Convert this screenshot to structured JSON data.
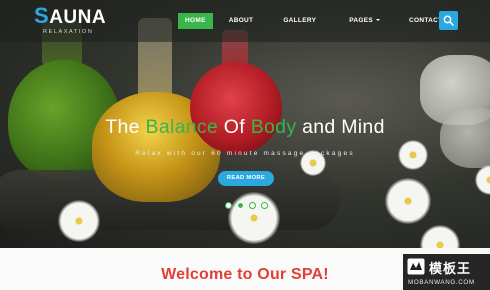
{
  "logo": {
    "first_letter": "S",
    "rest": "AUNA",
    "tagline": "RELAXATION"
  },
  "nav": {
    "items": [
      {
        "label": "HOME",
        "active": true
      },
      {
        "label": "ABOUT",
        "active": false
      },
      {
        "label": "GALLERY",
        "active": false
      },
      {
        "label": "PAGES",
        "active": false,
        "dropdown": true
      },
      {
        "label": "CONTACT",
        "active": false
      }
    ],
    "search_icon": "search-icon"
  },
  "hero": {
    "title_parts": [
      "The ",
      "Balance",
      " Of ",
      "Body",
      " and Mind"
    ],
    "subtitle": "Relax with our 60 minute massage packages",
    "button_label": "READ MORE",
    "slider_dots": 4,
    "active_dot": 1
  },
  "welcome": {
    "title": "Welcome to Our SPA!"
  },
  "watermark": {
    "chinese": "模板王",
    "english": "MOBANWANG.COM"
  },
  "colors": {
    "accent_blue": "#29a9e0",
    "accent_green": "#3ab54a",
    "welcome_red": "#e23f37"
  }
}
